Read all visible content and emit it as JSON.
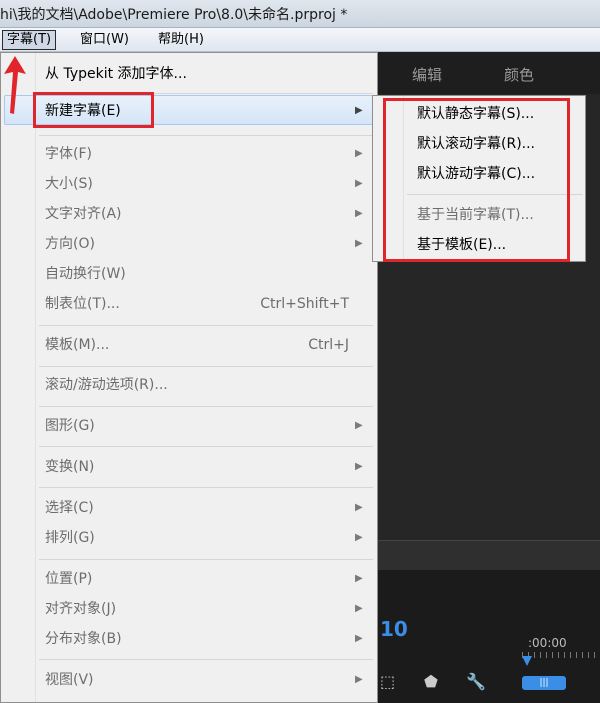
{
  "title": "hi\\我的文档\\Adobe\\Premiere Pro\\8.0\\未命名.prproj *",
  "menubar": [
    {
      "label": "字幕(T)",
      "active": true
    },
    {
      "label": "窗口(W)"
    },
    {
      "label": "帮助(H)"
    }
  ],
  "tabs": [
    "编辑",
    "颜色"
  ],
  "timeline": {
    "timecode": "10",
    "ruler_time": ":00:00"
  },
  "menu": {
    "typekit": "从 Typekit 添加字体...",
    "new_title": "新建字幕(E)",
    "font": "字体(F)",
    "size": "大小(S)",
    "align": "文字对齐(A)",
    "orientation": "方向(O)",
    "wrap": "自动换行(W)",
    "tab_stops": "制表位(T)...",
    "tab_stops_shortcut": "Ctrl+Shift+T",
    "templates": "模板(M)...",
    "templates_shortcut": "Ctrl+J",
    "roll_crawl": "滚动/游动选项(R)...",
    "graphic": "图形(G)",
    "transform": "变换(N)",
    "select": "选择(C)",
    "arrange": "排列(G)",
    "position": "位置(P)",
    "align_objects": "对齐对象(J)",
    "distribute_objects": "分布对象(B)",
    "view": "视图(V)"
  },
  "submenu": {
    "default_still": "默认静态字幕(S)...",
    "default_roll": "默认滚动字幕(R)...",
    "default_crawl": "默认游动字幕(C)...",
    "based_on_current": "基于当前字幕(T)...",
    "based_on_template": "基于模板(E)..."
  },
  "colors": {
    "annotation": "#e0262b",
    "accent": "#3a8ee6"
  }
}
